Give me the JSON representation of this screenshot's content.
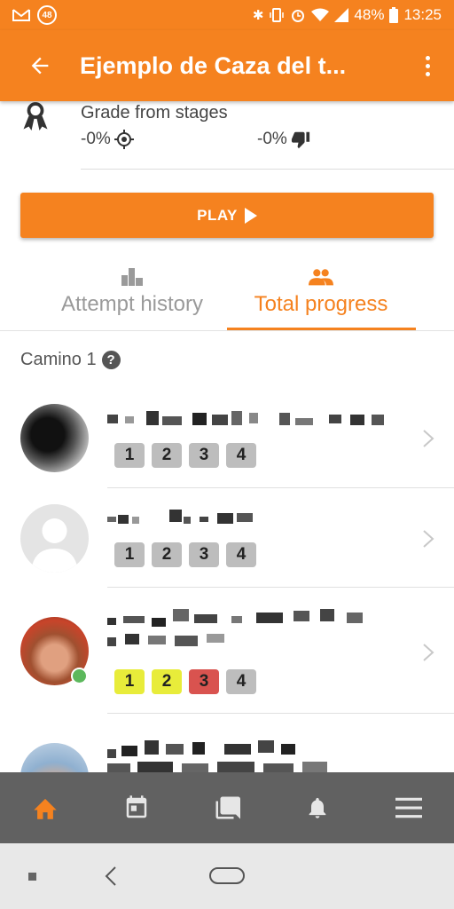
{
  "status_bar": {
    "badge": "48",
    "battery": "48%",
    "time": "13:25"
  },
  "app_bar": {
    "title": "Ejemplo de Caza del t..."
  },
  "grade": {
    "label": "Grade from stages",
    "correct_value": "-0%",
    "wrong_value": "-0%"
  },
  "play_button": {
    "label": "PLAY"
  },
  "tabs": [
    {
      "label": "Attempt history",
      "icon": "bar-chart-icon",
      "active": false
    },
    {
      "label": "Total progress",
      "icon": "people-icon",
      "active": true
    }
  ],
  "section": {
    "title": "Camino 1"
  },
  "participants": [
    {
      "badges": [
        {
          "n": "1",
          "status": "none"
        },
        {
          "n": "2",
          "status": "none"
        },
        {
          "n": "3",
          "status": "none"
        },
        {
          "n": "4",
          "status": "none"
        }
      ]
    },
    {
      "badges": [
        {
          "n": "1",
          "status": "none"
        },
        {
          "n": "2",
          "status": "none"
        },
        {
          "n": "3",
          "status": "none"
        },
        {
          "n": "4",
          "status": "none"
        }
      ]
    },
    {
      "online": true,
      "badges": [
        {
          "n": "1",
          "status": "yellow"
        },
        {
          "n": "2",
          "status": "yellow"
        },
        {
          "n": "3",
          "status": "red"
        },
        {
          "n": "4",
          "status": "none"
        }
      ]
    }
  ],
  "bottom_nav": [
    {
      "icon": "home-icon",
      "active": true
    },
    {
      "icon": "calendar-icon",
      "active": false
    },
    {
      "icon": "chat-icon",
      "active": false
    },
    {
      "icon": "bell-icon",
      "active": false
    },
    {
      "icon": "menu-icon",
      "active": false
    }
  ],
  "colors": {
    "accent": "#f5821f",
    "badge_neutral": "#bdbdbd",
    "badge_yellow": "#e8ec3a",
    "badge_red": "#d9534f",
    "nav_bg": "#616161"
  }
}
